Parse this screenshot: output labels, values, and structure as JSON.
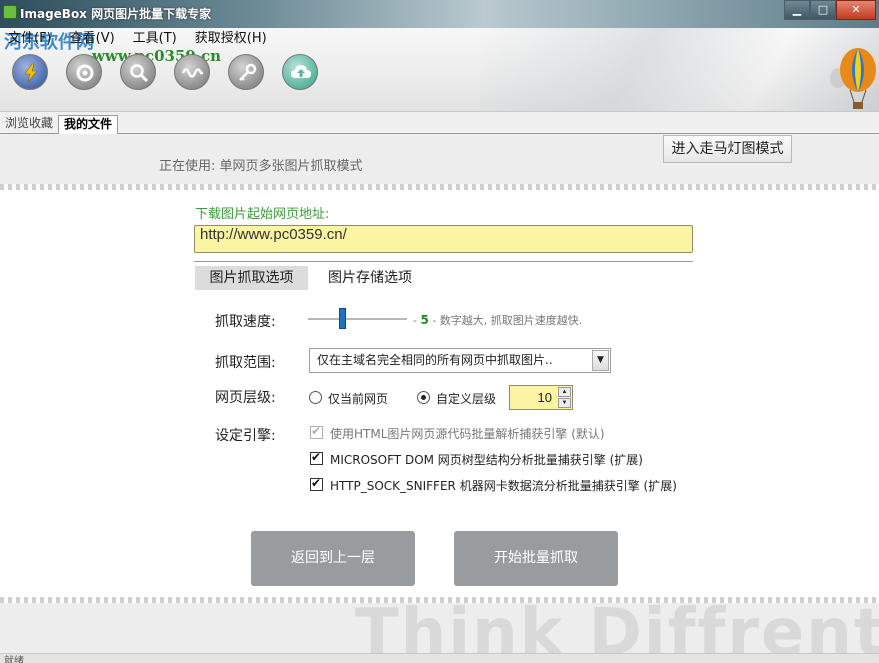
{
  "window": {
    "title": "ImageBox 网页图片批量下载专家",
    "icons": {
      "app": "app-icon",
      "minimize": "minimize-icon",
      "maximize": "maximize-icon",
      "close": "close-icon"
    }
  },
  "watermark": {
    "logo": "河东软件网",
    "url": "www.pc0359.cn"
  },
  "menu": {
    "items": [
      {
        "label": "文件(F)"
      },
      {
        "label": "查看(V)"
      },
      {
        "label": "工具(T)"
      },
      {
        "label": "获取授权(H)"
      }
    ]
  },
  "toolbar": {
    "icons": [
      "bolt-icon",
      "refresh-icon",
      "search-icon",
      "wave-icon",
      "key-icon",
      "cloud-upload-icon"
    ]
  },
  "tabs": [
    {
      "label": "浏览收藏",
      "active": false
    },
    {
      "label": "我的文件",
      "active": true
    }
  ],
  "mode": {
    "label": "正在使用: 单网页多张图片抓取模式",
    "marquee_button": "进入走马灯图模式"
  },
  "form": {
    "url_label": "下载图片起始网页地址:",
    "url_value": "http://www.pc0359.cn/",
    "option_tabs": [
      {
        "label": "图片抓取选项",
        "active": true
      },
      {
        "label": "图片存储选项",
        "active": false
      }
    ],
    "speed": {
      "label": "抓取速度:",
      "value": "5",
      "hint_prefix": "- ",
      "hint_suffix": " - 数字越大, 抓取图片速度越快.",
      "slider_fraction": 0.35
    },
    "range": {
      "label": "抓取范围:",
      "selected": "仅在主域名完全相同的所有网页中抓取图片.."
    },
    "level": {
      "label": "网页层级:",
      "option_current": "仅当前网页",
      "option_custom": "自定义层级",
      "selected": "custom",
      "value": "10"
    },
    "engine": {
      "label": "设定引擎:",
      "options": [
        {
          "label": "使用HTML图片网页源代码批量解析捕获引擎 (默认)",
          "checked": true,
          "disabled": true
        },
        {
          "label": "MICROSOFT DOM 网页树型结构分析批量捕获引擎 (扩展)",
          "checked": true,
          "disabled": false
        },
        {
          "label": "HTTP_SOCK_SNIFFER 机器网卡数据流分析批量捕获引擎 (扩展)",
          "checked": true,
          "disabled": false
        }
      ]
    },
    "buttons": {
      "back": "返回到上一层",
      "start": "开始批量抓取"
    }
  },
  "footer": {
    "slogan": "Think Diffrent",
    "status": "就绪"
  },
  "colors": {
    "url_input_bg": "#fbf4a2",
    "accent_green": "#3d9a3d",
    "slider_thumb": "#1f6fc4",
    "action_button": "#999c9e"
  }
}
